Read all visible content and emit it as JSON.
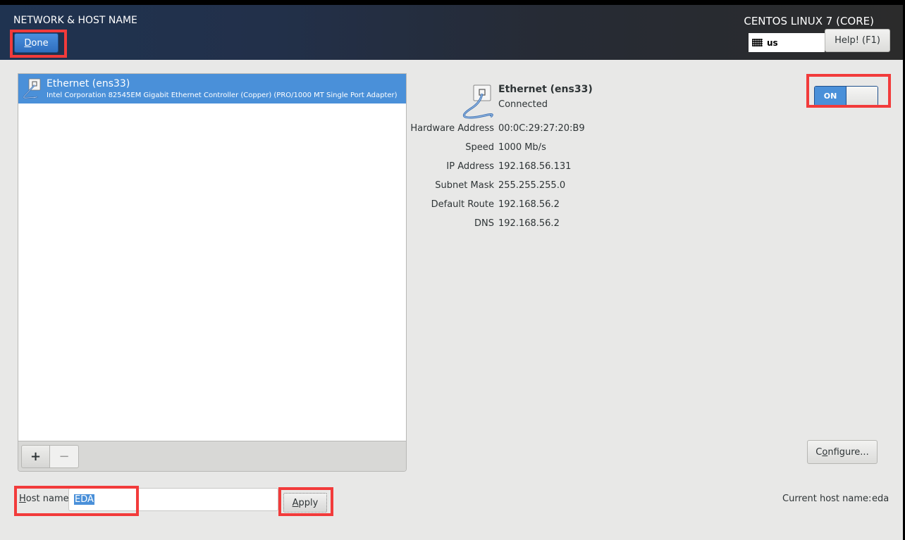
{
  "header": {
    "title": "NETWORK & HOST NAME",
    "done_label": "Done",
    "done_mnemonic": "D",
    "done_rest": "one",
    "product": "CENTOS LINUX 7 (CORE)",
    "keyboard_layout": "us",
    "help_label": "Help! (F1)"
  },
  "devices": [
    {
      "name": "Ethernet (ens33)",
      "description": "Intel Corporation 82545EM Gigabit Ethernet Controller (Copper) (PRO/1000 MT Single Port Adapter)",
      "selected": true
    }
  ],
  "list_toolbar": {
    "add_label": "+",
    "remove_label": "−"
  },
  "details": {
    "name": "Ethernet (ens33)",
    "status": "Connected",
    "rows": [
      {
        "label": "Hardware Address",
        "value": "00:0C:29:27:20:B9"
      },
      {
        "label": "Speed",
        "value": "1000 Mb/s"
      },
      {
        "label": "IP Address",
        "value": "192.168.56.131"
      },
      {
        "label": "Subnet Mask",
        "value": "255.255.255.0"
      },
      {
        "label": "Default Route",
        "value": "192.168.56.2"
      },
      {
        "label": "DNS",
        "value": "192.168.56.2"
      }
    ],
    "toggle_label": "ON",
    "toggle_state": true,
    "configure_mnemonic_pre": "C",
    "configure_mnemonic": "o",
    "configure_rest": "nfigure..."
  },
  "hostname": {
    "label_mnemonic": "H",
    "label_rest": "ost name:",
    "value": "EDA",
    "apply_mnemonic": "A",
    "apply_rest": "pply",
    "current_label": "Current host name:",
    "current_value": "eda"
  },
  "colors": {
    "accent": "#4a90d9",
    "highlight": "#f23b3b"
  }
}
